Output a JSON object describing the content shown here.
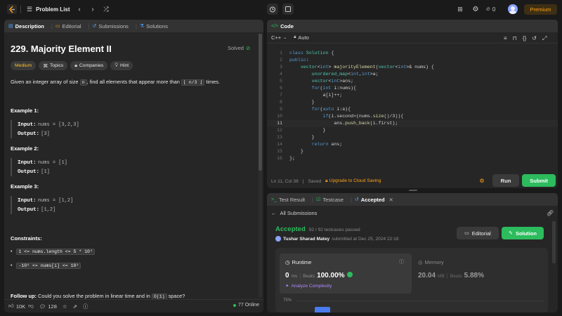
{
  "topbar": {
    "problem_list": "Problem List",
    "streak": "0",
    "premium": "Premium"
  },
  "left": {
    "tabs": [
      "Description",
      "Editorial",
      "Submissions",
      "Solutions"
    ],
    "title": "229. Majority Element II",
    "solved": "Solved",
    "tags": [
      "Medium",
      "Topics",
      "Companies",
      "Hint"
    ],
    "desc_pre": "Given an integer array of size",
    "desc_n": "n",
    "desc_mid": ", find all elements that appear more than",
    "desc_code": "⌊ n/3 ⌋",
    "desc_post": "times.",
    "examples": [
      {
        "h": "Example 1:",
        "input_label": "Input:",
        "input": "nums = [3,2,3]",
        "output_label": "Output:",
        "output": "[3]"
      },
      {
        "h": "Example 2:",
        "input_label": "Input:",
        "input": "nums = [1]",
        "output_label": "Output:",
        "output": "[1]"
      },
      {
        "h": "Example 3:",
        "input_label": "Input:",
        "input": "nums = [1,2]",
        "output_label": "Output:",
        "output": "[1,2]"
      }
    ],
    "constraints_h": "Constraints:",
    "constraints": [
      "1 <= nums.length <= 5 * 10⁴",
      "-10⁹ <= nums[i] <= 10⁹"
    ],
    "followup_label": "Follow up:",
    "followup_text": "Could you solve the problem in linear time and in",
    "followup_code": "O(1)",
    "followup_end": "space?",
    "likes": "10K",
    "comments": "128",
    "online": "77 Online"
  },
  "code": {
    "tab": "Code",
    "lang": "C++",
    "auto": "Auto",
    "lines": [
      "class Solution {",
      "public:",
      "    vector<int> majorityElement(vector<int>& nums) {",
      "        unordered_map<int,int>a;",
      "        vector<int>ans;",
      "        for(int i:nums){",
      "            a[i]++;",
      "        }",
      "        for(auto i:a){",
      "            if(i.second>(nums.size()/3)){",
      "                ans.push_back(i.first);",
      "            }",
      "        }",
      "        return ans;",
      "    }",
      "};"
    ],
    "status": "Ln 11, Col 38",
    "saved": "Saved",
    "upgrade": "Upgrade to Cloud Saving",
    "run": "Run",
    "submit": "Submit"
  },
  "result": {
    "tabs": [
      "Test Result",
      "Testcase",
      "Accepted"
    ],
    "all_subs": "All Submissions",
    "accepted": "Accepted",
    "passed": "92 / 92 testcases passed",
    "user": "Tushar Sharad Matey",
    "submitted": "submitted at Dec 25, 2024 22:18",
    "editorial": "Editorial",
    "solution": "Solution",
    "runtime_h": "Runtime",
    "runtime_val": "0",
    "runtime_unit": "ms",
    "beats": "Beats",
    "runtime_beats": "100.00%",
    "analyze": "Analyze Complexity",
    "memory_h": "Memory",
    "memory_val": "20.04",
    "memory_unit": "MB",
    "memory_beats": "5.88%",
    "axis": "75%"
  },
  "colors": {
    "accent": "#ffa116",
    "green": "#2cbb5d",
    "medium": "#ffc01e"
  }
}
